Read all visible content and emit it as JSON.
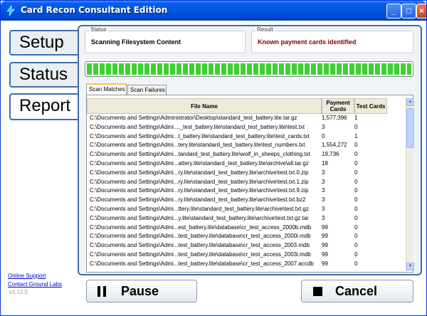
{
  "window": {
    "title": "Card Recon Consultant Edition",
    "minimize": "_",
    "maximize": "□",
    "close": "×"
  },
  "nav": {
    "setup": "Setup",
    "status": "Status",
    "report": "Report"
  },
  "status": {
    "label": "Status",
    "value": "Scanning Filesystem Content"
  },
  "result": {
    "label": "Result",
    "value": "Known payment cards identified"
  },
  "progress": {
    "percent": 100
  },
  "tabs": {
    "matches": "Scan Matches",
    "failures": "Scan Failures"
  },
  "table": {
    "headers": {
      "file": "File Name",
      "payment": "Payment Cards",
      "test": "Test Cards"
    },
    "rows": [
      {
        "file": "C:\\Documents and Settings\\Administrator\\Desktop\\standard_test_battery.lite.tar.gz",
        "payment": "1,577,396",
        "test": "1"
      },
      {
        "file": "C:\\Documents and Settings\\Admi...._test_battery.lite\\standard_test_battery.lite\\test.txt",
        "payment": "3",
        "test": "0"
      },
      {
        "file": "C:\\Documents and Settings\\Admi...t_battery.lite\\standard_test_battery.lite\\test_cards.txt",
        "payment": "0",
        "test": "1"
      },
      {
        "file": "C:\\Documents and Settings\\Admi...tery.lite\\standard_test_battery.lite\\test_numbers.txt",
        "payment": "1,554,272",
        "test": "0"
      },
      {
        "file": "C:\\Documents and Settings\\Admi...tandard_test_battery.lite\\wolf_in_sheeps_clothing.txt",
        "payment": "19,736",
        "test": "0"
      },
      {
        "file": "C:\\Documents and Settings\\Admi...attery.lite\\standard_test_battery.lite\\archive\\all.tar.gz",
        "payment": "18",
        "test": "0"
      },
      {
        "file": "C:\\Documents and Settings\\Admi...ry.lite\\standard_test_battery.lite\\archive\\test.txt.0.zip",
        "payment": "3",
        "test": "0"
      },
      {
        "file": "C:\\Documents and Settings\\Admi...ry.lite\\standard_test_battery.lite\\archive\\test.txt.1.zip",
        "payment": "3",
        "test": "0"
      },
      {
        "file": "C:\\Documents and Settings\\Admi...ry.lite\\standard_test_battery.lite\\archive\\test.txt.9.zip",
        "payment": "3",
        "test": "0"
      },
      {
        "file": "C:\\Documents and Settings\\Admi...ry.lite\\standard_test_battery.lite\\archive\\test.txt.bz2",
        "payment": "3",
        "test": "0"
      },
      {
        "file": "C:\\Documents and Settings\\Admi...ttery.lite\\standard_test_battery.lite\\archive\\test.txt.gz",
        "payment": "3",
        "test": "0"
      },
      {
        "file": "C:\\Documents and Settings\\Admi...y.lite\\standard_test_battery.lite\\archive\\test.txt.gz.tar",
        "payment": "3",
        "test": "0"
      },
      {
        "file": "C:\\Documents and Settings\\Admi...est_battery.lite\\database\\cr_test_access_2000b.mdb",
        "payment": "99",
        "test": "0"
      },
      {
        "file": "C:\\Documents and Settings\\Admi...test_battery.lite\\database\\cr_test_access_2000i.mdb",
        "payment": "99",
        "test": "0"
      },
      {
        "file": "C:\\Documents and Settings\\Admi...test_battery.lite\\database\\cr_test_access_2003.mdb",
        "payment": "99",
        "test": "0"
      },
      {
        "file": "C:\\Documents and Settings\\Admi...test_battery.lite\\database\\cr_test_access_2003i.mdb",
        "payment": "99",
        "test": "0"
      },
      {
        "file": "C:\\Documents and Settings\\Admi...test_battery.lite\\database\\cr_test_access_2007.accdb",
        "payment": "99",
        "test": "0"
      },
      {
        "file": "C:\\Documents and Settings\\Admi...st_battery.lite\\database\\cr_test_access_2007i.accdb",
        "payment": "99",
        "test": "0"
      }
    ]
  },
  "buttons": {
    "pause": "Pause",
    "cancel": "Cancel"
  },
  "footer": {
    "support": "Online Support",
    "contact": "Contact Ground Labs",
    "version": "v1.12.5"
  },
  "colors": {
    "accent": "#3d6fa8",
    "progress": "#3ed132",
    "result_text": "#800000"
  }
}
